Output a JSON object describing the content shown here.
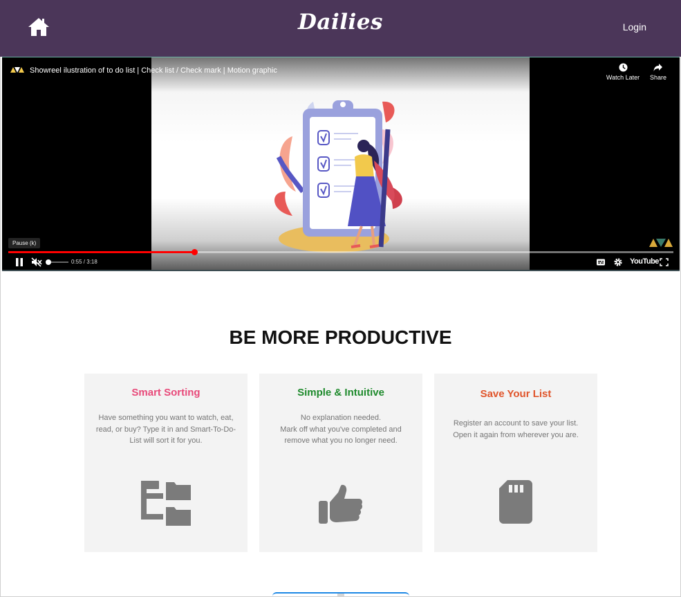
{
  "header": {
    "brand": "Dailies",
    "login_label": "Login",
    "home_icon": "home-icon",
    "background": "#4b3659"
  },
  "video": {
    "title": "Showreel ilustration of to do list | Check list / Check mark | Motion graphic",
    "watch_later_label": "Watch Later",
    "share_label": "Share",
    "tooltip": "Pause (k)",
    "time": "0:55 / 3:18",
    "progress": 0.28,
    "youtube_label": "YouTube",
    "progress_color": "#ff0000"
  },
  "section": {
    "title": "BE MORE PRODUCTIVE",
    "cards": [
      {
        "title": "Smart Sorting",
        "title_color": "#e84a7a",
        "desc_lines": [
          "Have something you want to watch, eat,",
          "read, or buy? Type it in and Smart-To-Do-",
          "List will sort it for you."
        ],
        "icon": "folder-tree-icon"
      },
      {
        "title": "Simple & Intuitive",
        "title_color": "#1e8a2c",
        "desc_lines": [
          "No explanation needed.",
          "Mark off what you've completed and",
          "remove what you no longer need."
        ],
        "icon": "thumbs-up-icon"
      },
      {
        "title": "Save Your List",
        "title_color": "#e0542a",
        "desc_lines": [
          "Register an account to save your list.",
          "Open it again from wherever you are."
        ],
        "icon": "sd-card-icon"
      }
    ]
  }
}
